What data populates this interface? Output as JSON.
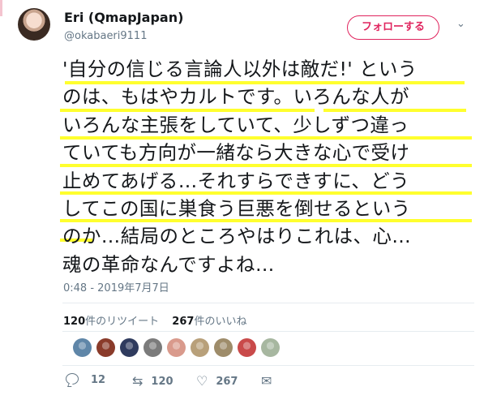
{
  "user": {
    "display_name": "Eri (QmapJapan)",
    "handle": "@okabaeri9111"
  },
  "header": {
    "follow_label": "フォローする",
    "menu_icon": "chevron-down-icon"
  },
  "tweet": {
    "lines": [
      "'自分の信じる言論人以外は敵だ!' という",
      "のは、もはやカルトです。いろんな人が",
      "いろんな主張をしていて、少しずつ違っ",
      "ていても方向が一緒なら大きな心で受け",
      "止めてあげる…それすらできすに、どう",
      "してこの国に巣食う巨悪を倒せるという",
      "のか…結局のところやはりこれは、心…",
      "魂の革命なんですよね…"
    ],
    "highlight_color": "#ffff2e",
    "timestamp": "0:48 - 2019年7月7日"
  },
  "stats": {
    "retweet_count": "120",
    "retweet_label": "件のリツイート",
    "like_count": "267",
    "like_label": "件のいいね"
  },
  "likers": [
    {
      "name": "liker-avatar-1",
      "color": "#5f86a8"
    },
    {
      "name": "liker-avatar-2",
      "color": "#8a3b2a"
    },
    {
      "name": "liker-avatar-3",
      "color": "#2f3b5e"
    },
    {
      "name": "liker-avatar-4",
      "color": "#7b7b7b"
    },
    {
      "name": "liker-avatar-5",
      "color": "#d99a8c"
    },
    {
      "name": "liker-avatar-6",
      "color": "#b8a07a"
    },
    {
      "name": "liker-avatar-7",
      "color": "#9e8c6a"
    },
    {
      "name": "liker-avatar-8",
      "color": "#c94a4a"
    },
    {
      "name": "liker-avatar-9",
      "color": "#a7b7a0"
    }
  ],
  "actions": {
    "reply_count": "12",
    "retweet_count": "120",
    "like_count": "267"
  },
  "colors": {
    "accent": "#e0245e",
    "muted_text": "#657786",
    "divider": "#e6ecf0"
  }
}
